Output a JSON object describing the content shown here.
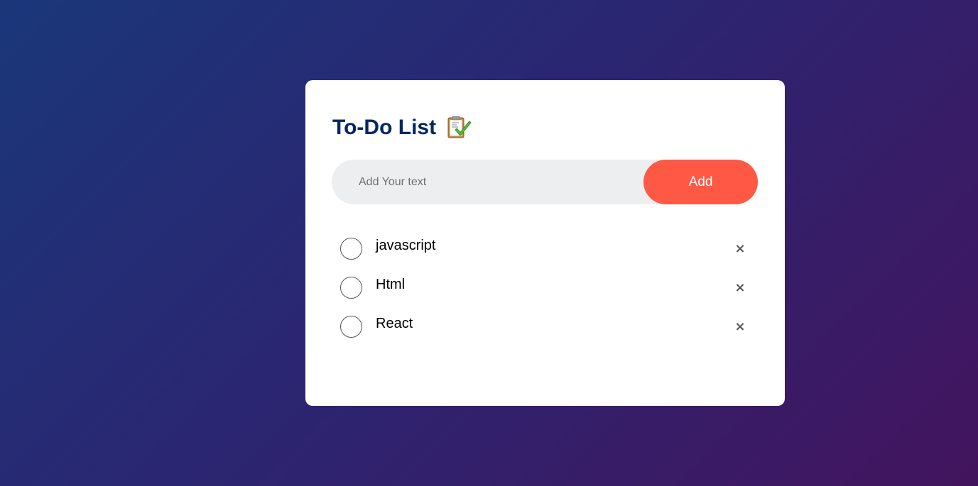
{
  "app": {
    "title": "To-Do List",
    "title_icon": "clipboard-check-icon"
  },
  "input": {
    "placeholder": "Add Your text",
    "value": "",
    "add_label": "Add"
  },
  "tasks": [
    {
      "label": "javascript",
      "checked": false,
      "remove_label": "×"
    },
    {
      "label": "Html",
      "checked": false,
      "remove_label": "×"
    },
    {
      "label": "React",
      "checked": false,
      "remove_label": "×"
    }
  ],
  "colors": {
    "title": "#002765",
    "accent": "#ff5945",
    "input_bg": "#edeef0",
    "bg_start": "#1a377a",
    "bg_end": "#43145e"
  }
}
